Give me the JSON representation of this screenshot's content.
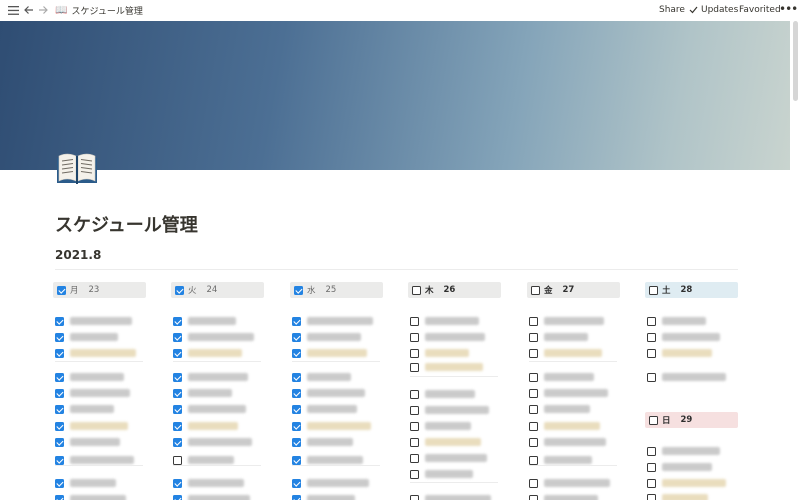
{
  "topbar": {
    "menu_icon": "hamburger-icon",
    "back_icon": "arrow-left-icon",
    "forward_icon": "arrow-right-icon",
    "page_icon": "open-book-icon",
    "breadcrumb_title": "スケジュール管理",
    "share_label": "Share",
    "updates_label": "Updates",
    "updates_icon": "check-icon",
    "favorited_label": "Favorited",
    "more_icon": "more-icon"
  },
  "page": {
    "title": "スケジュール管理",
    "subheading": "2021.8",
    "icon": "open-book-icon"
  },
  "colors": {
    "checkbox_checked": "#2383e2",
    "header_gray": "#ebebea",
    "header_blue": "#dfecf2",
    "header_pink": "#f6e0e0"
  },
  "days": [
    {
      "day": "月",
      "date": "23",
      "checked": true,
      "style": "gray",
      "items": [
        {
          "checked": true,
          "tone": "g"
        },
        {
          "checked": true,
          "tone": "g"
        },
        {
          "checked": true,
          "tone": "y"
        },
        {
          "checked": true,
          "tone": "g"
        },
        {
          "checked": true,
          "tone": "g"
        },
        {
          "checked": true,
          "tone": "g"
        },
        {
          "checked": true,
          "tone": "y"
        },
        {
          "checked": true,
          "tone": "g"
        },
        {
          "checked": true,
          "tone": "g"
        },
        {
          "checked": true,
          "tone": "g"
        },
        {
          "checked": true,
          "tone": "g"
        }
      ]
    },
    {
      "day": "火",
      "date": "24",
      "checked": true,
      "style": "gray",
      "items": [
        {
          "checked": true,
          "tone": "g"
        },
        {
          "checked": true,
          "tone": "g"
        },
        {
          "checked": true,
          "tone": "y"
        },
        {
          "checked": true,
          "tone": "g"
        },
        {
          "checked": true,
          "tone": "g"
        },
        {
          "checked": true,
          "tone": "g"
        },
        {
          "checked": true,
          "tone": "y"
        },
        {
          "checked": true,
          "tone": "g"
        },
        {
          "checked": false,
          "tone": "g"
        },
        {
          "checked": true,
          "tone": "g"
        },
        {
          "checked": true,
          "tone": "g"
        }
      ]
    },
    {
      "day": "水",
      "date": "25",
      "checked": true,
      "style": "gray",
      "items": [
        {
          "checked": true,
          "tone": "g"
        },
        {
          "checked": true,
          "tone": "g"
        },
        {
          "checked": true,
          "tone": "y"
        },
        {
          "checked": true,
          "tone": "g"
        },
        {
          "checked": true,
          "tone": "g"
        },
        {
          "checked": true,
          "tone": "g"
        },
        {
          "checked": true,
          "tone": "y"
        },
        {
          "checked": true,
          "tone": "g"
        },
        {
          "checked": true,
          "tone": "g"
        },
        {
          "checked": true,
          "tone": "g"
        },
        {
          "checked": true,
          "tone": "g"
        }
      ]
    },
    {
      "day": "木",
      "date": "26",
      "checked": false,
      "style": "gray",
      "bold": true,
      "items": [
        {
          "checked": false,
          "tone": "g"
        },
        {
          "checked": false,
          "tone": "g"
        },
        {
          "checked": false,
          "tone": "y"
        },
        {
          "checked": false,
          "tone": "y"
        },
        {
          "checked": false,
          "tone": "g"
        },
        {
          "checked": false,
          "tone": "g"
        },
        {
          "checked": false,
          "tone": "g"
        },
        {
          "checked": false,
          "tone": "y"
        },
        {
          "checked": false,
          "tone": "g"
        },
        {
          "checked": false,
          "tone": "g"
        },
        {
          "checked": false,
          "tone": "g"
        }
      ]
    },
    {
      "day": "金",
      "date": "27",
      "checked": false,
      "style": "gray",
      "bold": true,
      "items": [
        {
          "checked": false,
          "tone": "g"
        },
        {
          "checked": false,
          "tone": "g"
        },
        {
          "checked": false,
          "tone": "y"
        },
        {
          "checked": false,
          "tone": "g"
        },
        {
          "checked": false,
          "tone": "g"
        },
        {
          "checked": false,
          "tone": "g"
        },
        {
          "checked": false,
          "tone": "y"
        },
        {
          "checked": false,
          "tone": "g"
        },
        {
          "checked": false,
          "tone": "g"
        },
        {
          "checked": false,
          "tone": "g"
        },
        {
          "checked": false,
          "tone": "g"
        }
      ]
    },
    {
      "day": "土",
      "date": "28",
      "checked": false,
      "style": "blue",
      "bold": true,
      "items": [
        {
          "checked": false,
          "tone": "g"
        },
        {
          "checked": false,
          "tone": "g"
        },
        {
          "checked": false,
          "tone": "y"
        },
        {
          "checked": false,
          "tone": "g"
        }
      ]
    },
    {
      "day": "日",
      "date": "29",
      "checked": false,
      "style": "pink",
      "bold": true,
      "items": [
        {
          "checked": false,
          "tone": "g"
        },
        {
          "checked": false,
          "tone": "g"
        },
        {
          "checked": false,
          "tone": "y"
        },
        {
          "checked": false,
          "tone": "y"
        }
      ]
    }
  ]
}
